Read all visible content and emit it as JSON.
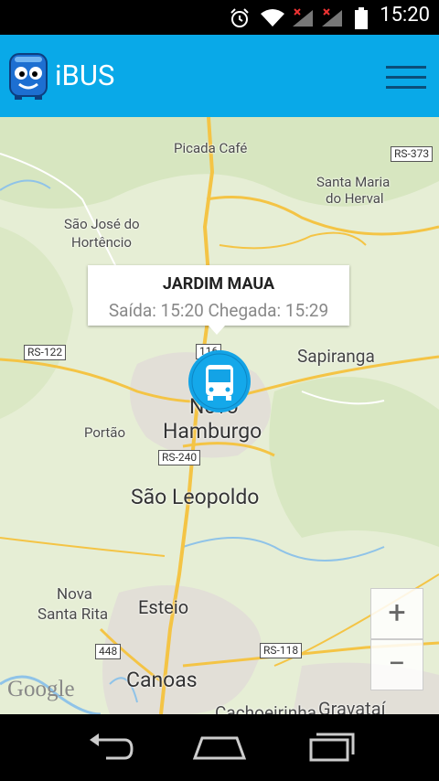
{
  "status_bar": {
    "time": "15:20"
  },
  "app_bar": {
    "title": "iBUS"
  },
  "map": {
    "places": {
      "picada_cafe": "Picada Café",
      "santa_maria": "Santa Maria",
      "do_herval": "do Herval",
      "sao_jose": "São José do",
      "hortencio": "Hortêncio",
      "sapiranga": "Sapiranga",
      "portao": "Portão",
      "novo_hamburgo_a": "Novo",
      "novo_hamburgo_b": "Hamburgo",
      "sao_leopoldo": "São Leopoldo",
      "nova_santa_rita_a": "Nova",
      "nova_santa_rita_b": "Santa Rita",
      "esteio": "Esteio",
      "canoas": "Canoas",
      "cachoeirinha": "Cachoeirinha",
      "gravatai": "Gravataí"
    },
    "routes": {
      "rs373": "RS-373",
      "rs122": "RS-122",
      "br116": "116",
      "rs240": "RS-240",
      "br448": "448",
      "rs118": "RS-118"
    },
    "attribution": "Google"
  },
  "callout": {
    "title": "JARDIM MAUA",
    "info": "Saída: 15:20 Chegada: 15:29"
  },
  "zoom": {
    "in": "+",
    "out": "−"
  }
}
